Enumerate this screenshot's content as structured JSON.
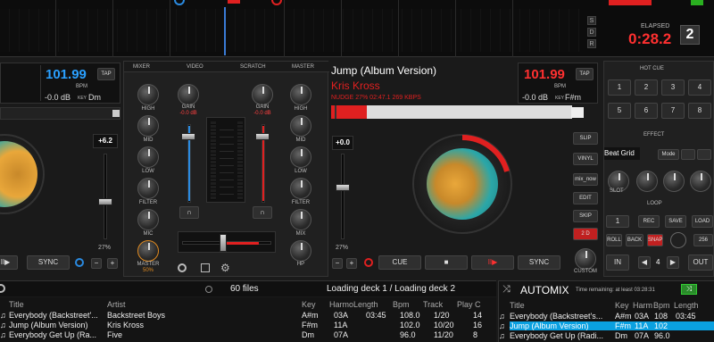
{
  "top": {
    "elapsed_label": "ELAPSED",
    "elapsed": "0:28.2",
    "deck_number": "2",
    "s_btn": "S",
    "d_btn": "D",
    "r_btn": "R"
  },
  "deck_left": {
    "bpm": "101.99",
    "bpm_label": "BPM",
    "tap": "TAP",
    "gain_db": "-0.0 dB",
    "key_label": "KEY",
    "key": "Dm",
    "pitch": "+6.2",
    "pitch_pct": "27%",
    "sync": "SYNC",
    "minus": "−",
    "plus": "+"
  },
  "deck_right": {
    "title": "Jump (Album Version)",
    "artist": "Kris Kross",
    "info": "NUDGE  27%  02:47.1  269 KBPS",
    "bpm": "101.99",
    "bpm_label": "BPM",
    "tap": "TAP",
    "gain_db": "-0.0 dB",
    "key_label": "KEY",
    "key": "F#m",
    "pitch": "+0.0",
    "pitch_pct": "27%",
    "cue": "CUE",
    "stop": "■",
    "play": "II▶",
    "sync": "SYNC",
    "minus": "−",
    "plus": "+",
    "side": [
      "SLIP",
      "VINYL",
      "mix_now",
      "EDIT",
      "SKIP",
      "2 D"
    ],
    "custom": "CUSTOM"
  },
  "mixer": {
    "tabs": [
      "MIXER",
      "VIDEO",
      "SCRATCH",
      "MASTER"
    ],
    "left_knobs": [
      "HIGH",
      "MID",
      "LOW",
      "FILTER",
      "MIC",
      "MASTER"
    ],
    "master_pct": "50%",
    "right_knobs": [
      "HIGH",
      "MID",
      "LOW",
      "FILTER",
      "MIX",
      "HP"
    ],
    "gain_label": "GAIN",
    "gain_left_db": "-0.0 dB",
    "gain_right_db": "-0.0 dB"
  },
  "fx_panel": {
    "hot_cue": "HOT CUE",
    "cues": [
      "1",
      "2",
      "3",
      "4",
      "5",
      "6",
      "7",
      "8"
    ],
    "effect": "EFFECT",
    "effect_name": "Beat Grid",
    "mode": "Mode",
    "slot": "SLOT",
    "loop": "LOOP",
    "loop_buttons": [
      "1",
      "REC",
      "SAVE",
      "LOAD"
    ],
    "roll": "ROLL",
    "back": "BACK",
    "snap": "SNAP",
    "loop_size": "256",
    "in": "IN",
    "loop_len": "4",
    "out": "OUT"
  },
  "browser": {
    "file_count": "60 files",
    "status": "Loading deck 1 / Loading deck 2",
    "columns": [
      "Title",
      "Artist",
      "Key",
      "Harmo",
      "Length",
      "Bpm",
      "Track",
      "Play C"
    ],
    "rows": [
      [
        "Everybody (Backstreet'...",
        "Backstreet Boys",
        "A#m",
        "03A",
        "03:45",
        "108.0",
        "1/20",
        "14"
      ],
      [
        "Jump (Album Version)",
        "Kris Kross",
        "F#m",
        "11A",
        "",
        "102.0",
        "10/20",
        "16"
      ],
      [
        "Everybody Get Up (Ra...",
        "Five",
        "Dm",
        "07A",
        "",
        "96.0",
        "11/20",
        "8"
      ]
    ]
  },
  "automix": {
    "title": "AUTOMIX",
    "remaining": "Time remaining: at least 03:28:31",
    "columns": [
      "Title",
      "Key",
      "Harm",
      "Bpm",
      "Length"
    ],
    "rows": [
      [
        "Everybody (Backstreet's...",
        "A#m",
        "03A",
        "108",
        "03:45"
      ],
      [
        "Jump (Album Version)",
        "F#m",
        "11A",
        "102",
        ""
      ],
      [
        "Everybody Get Up (Radi...",
        "Dm",
        "07A",
        "96.0",
        ""
      ]
    ]
  },
  "colors": {
    "accent_blue": "#0aa0e0",
    "accent_red": "#e02020",
    "elapsed_red": "#ff3030"
  }
}
